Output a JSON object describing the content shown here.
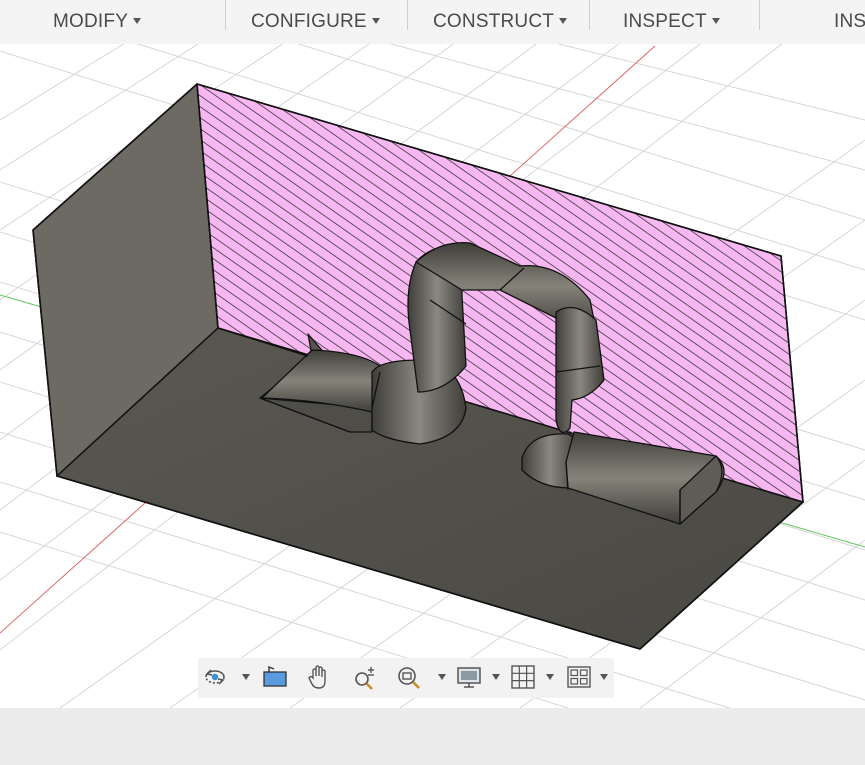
{
  "toolbar": {
    "menus": [
      {
        "label": "MODIFY"
      },
      {
        "label": "CONFIGURE"
      },
      {
        "label": "CONSTRUCT"
      },
      {
        "label": "INSPECT"
      },
      {
        "label": "INS"
      }
    ]
  },
  "navigation_bar": {
    "tools": [
      {
        "icon": "orbit-icon",
        "has_dropdown": true
      },
      {
        "icon": "look-at-icon",
        "has_dropdown": false
      },
      {
        "icon": "pan-hand-icon",
        "has_dropdown": false
      },
      {
        "icon": "zoom-icon",
        "has_dropdown": false
      },
      {
        "icon": "fit-zoom-icon",
        "has_dropdown": true
      },
      {
        "icon": "display-settings-icon",
        "has_dropdown": true
      },
      {
        "icon": "grid-snaps-icon",
        "has_dropdown": true
      },
      {
        "icon": "viewports-icon",
        "has_dropdown": true
      }
    ]
  },
  "colors": {
    "section_fill": "#f7b8f2",
    "hatch": "#222222",
    "body_dark": "#4d4b46",
    "body_side": "#6d6a63",
    "x_axis": "#e06666",
    "y_axis": "#5cc65c",
    "grid": "#d6d6d6"
  }
}
